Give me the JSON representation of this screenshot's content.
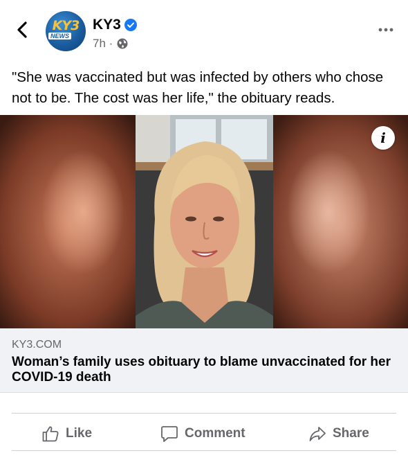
{
  "post": {
    "page_name": "KY3",
    "verified": true,
    "timestamp": "7h ·",
    "avatar_logo_text": "KY3",
    "avatar_logo_subtext": "NEWS",
    "caption": "\"She was vaccinated but was infected by others who chose not to be. The cost was her life,\" the obituary reads."
  },
  "link": {
    "domain": "KY3.COM",
    "title": "Woman’s family uses obituary to blame unvaccinated for her COVID-19 death"
  },
  "image": {
    "info_label": "i"
  },
  "actions": {
    "like": "Like",
    "comment": "Comment",
    "share": "Share"
  },
  "colors": {
    "verified_blue": "#1877f2",
    "secondary_text": "#65676b",
    "link_box_bg": "#f0f2f5"
  }
}
